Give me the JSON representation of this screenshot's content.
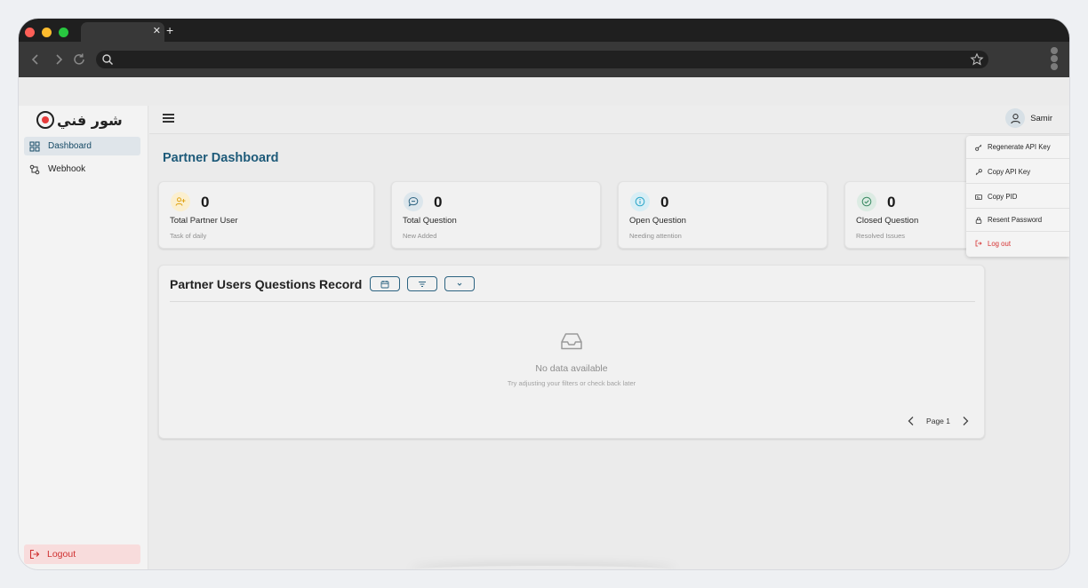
{
  "app": {
    "logo_text": "شور فني"
  },
  "sidebar": {
    "items": [
      {
        "label": "Dashboard",
        "icon": "dashboard-grid-icon",
        "active": true
      },
      {
        "label": "Webhook",
        "icon": "webhook-icon",
        "active": false
      }
    ],
    "logout_label": "Logout"
  },
  "header": {
    "user_name": "Samir"
  },
  "page": {
    "title": "Partner Dashboard"
  },
  "cards": [
    {
      "value": "0",
      "label": "Total Partner User",
      "sub": "Task of daily",
      "icon": "user-plus-icon",
      "color": "#f2b632"
    },
    {
      "value": "0",
      "label": "Total Question",
      "sub": "New Added",
      "icon": "chat-bubble-icon",
      "color": "#2c6381"
    },
    {
      "value": "0",
      "label": "Open Question",
      "sub": "Needing attention",
      "icon": "info-circle-icon",
      "color": "#2aa6c9"
    },
    {
      "value": "0",
      "label": "Closed Question",
      "sub": "Resolved Issues",
      "icon": "check-circle-icon",
      "color": "#3a8a63"
    }
  ],
  "records": {
    "title": "Partner Users Questions Record",
    "empty_title": "No data available",
    "empty_sub": "Try adjusting your filters or check back later",
    "page_label": "Page 1"
  },
  "user_menu": {
    "items": [
      {
        "label": "Regenerate API Key",
        "icon": "key-icon"
      },
      {
        "label": "Copy API Key",
        "icon": "key-icon"
      },
      {
        "label": "Copy PID",
        "icon": "id-card-icon"
      },
      {
        "label": "Resent Password",
        "icon": "lock-icon"
      },
      {
        "label": "Log out",
        "icon": "logout-icon"
      }
    ]
  },
  "colors": {
    "primary": "#1d5a79",
    "danger": "#d63232",
    "active_bg": "#dfe5ea"
  }
}
